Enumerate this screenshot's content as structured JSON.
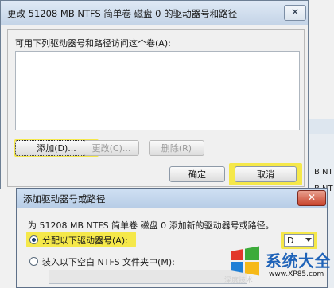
{
  "dialog_main": {
    "title": "更改 51208 MB NTFS 简单卷 磁盘 0 的驱动器号和路径",
    "close_glyph": "✕",
    "list_label": "可用下列驱动器号和路径访问这个卷(A):",
    "buttons": {
      "add": "添加(D)...",
      "change": "更改(C)...",
      "remove": "删除(R)",
      "ok": "确定",
      "cancel": "取消"
    }
  },
  "dialog_add": {
    "title": "添加驱动器号或路径",
    "close_glyph": "✕",
    "description": "为 51208 MB NTFS 简单卷 磁盘 0 添加新的驱动器号或路径。",
    "option_assign": "分配以下驱动器号(A):",
    "option_mount": "装入以下空白 NTFS 文件夹中(M):",
    "drive_letter": "D",
    "folder_path_value": ""
  },
  "background_window": {
    "side_text_1": "B NT",
    "side_text_2": "B NT"
  },
  "watermark": {
    "brand": "系统大全",
    "url": "www.XP85.com",
    "faded": "深度技术"
  },
  "colors": {
    "highlight": "#f5e84a",
    "titlebar_top": "#dfe9f5",
    "close_red": "#c8442d",
    "watermark_blue": "#1f63b8"
  }
}
